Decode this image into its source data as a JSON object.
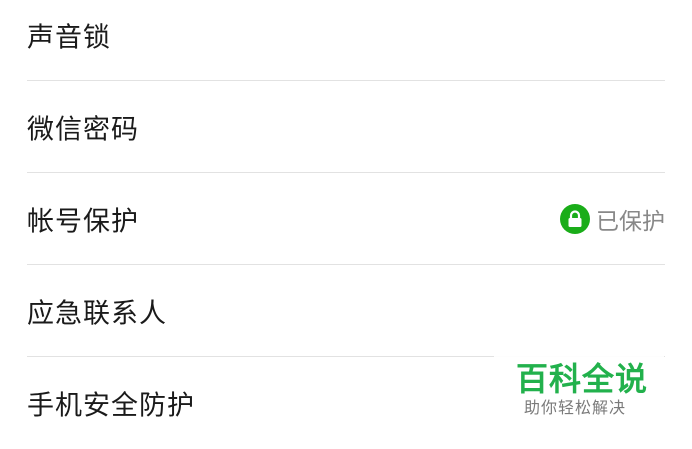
{
  "settings": {
    "items": [
      {
        "label": "声音锁"
      },
      {
        "label": "微信密码"
      },
      {
        "label": "帐号保护",
        "status": "已保护",
        "status_icon": "lock-icon"
      },
      {
        "label": "应急联系人"
      },
      {
        "label": "手机安全防护"
      }
    ]
  },
  "watermark": {
    "title": "百科全说",
    "subtitle": "助你轻松解决"
  },
  "colors": {
    "accent_green": "#1aad19",
    "watermark_green": "#22b14c",
    "divider": "#e2e2e2",
    "text": "#1a1a1a",
    "muted": "#888888"
  }
}
